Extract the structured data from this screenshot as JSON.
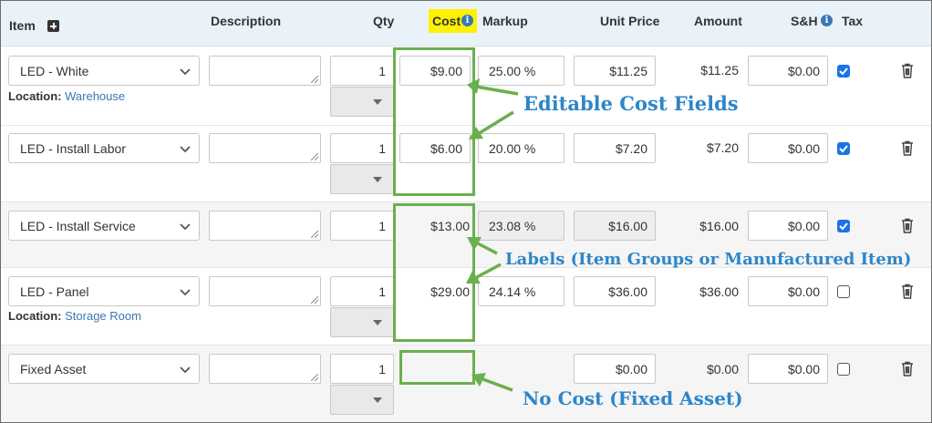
{
  "header": {
    "item": "Item",
    "description": "Description",
    "qty": "Qty",
    "cost": "Cost",
    "markup": "Markup",
    "unit_price": "Unit Price",
    "amount": "Amount",
    "sh": "S&H",
    "tax": "Tax"
  },
  "location_label": "Location:",
  "rows": [
    {
      "item": "LED - White",
      "qty": "1",
      "cost": "$9.00",
      "cost_editable": true,
      "markup": "25.00 %",
      "unit_price": "$11.25",
      "amount": "$11.25",
      "sh": "$0.00",
      "tax": true,
      "location": "Warehouse"
    },
    {
      "item": "LED - Install Labor",
      "qty": "1",
      "cost": "$6.00",
      "cost_editable": true,
      "markup": "20.00 %",
      "unit_price": "$7.20",
      "amount": "$7.20",
      "sh": "$0.00",
      "tax": true
    },
    {
      "item": "LED - Install Service",
      "qty": "1",
      "cost": "$13.00",
      "cost_editable": false,
      "markup": "23.08 %",
      "unit_price": "$16.00",
      "amount": "$16.00",
      "sh": "$0.00",
      "tax": true,
      "disabled_pricing": true
    },
    {
      "item": "LED - Panel",
      "qty": "1",
      "cost": "$29.00",
      "cost_editable": false,
      "markup": "24.14 %",
      "unit_price": "$36.00",
      "amount": "$36.00",
      "sh": "$0.00",
      "tax": false,
      "location": "Storage Room"
    },
    {
      "item": "Fixed Asset",
      "qty": "1",
      "cost": "",
      "cost_editable": false,
      "markup": "",
      "unit_price": "$0.00",
      "amount": "$0.00",
      "sh": "$0.00",
      "tax": false
    }
  ],
  "annotations": {
    "editable": "Editable Cost Fields",
    "labels": "Labels (Item Groups or Manufactured Item)",
    "no_cost": "No Cost (Fixed Asset)"
  },
  "colors": {
    "annotation_green": "#6ab04c",
    "annotation_text": "#2e86c8",
    "header_bg": "#eaf2f9",
    "cost_highlight": "#fff200",
    "checkbox_blue": "#1a73e8"
  }
}
